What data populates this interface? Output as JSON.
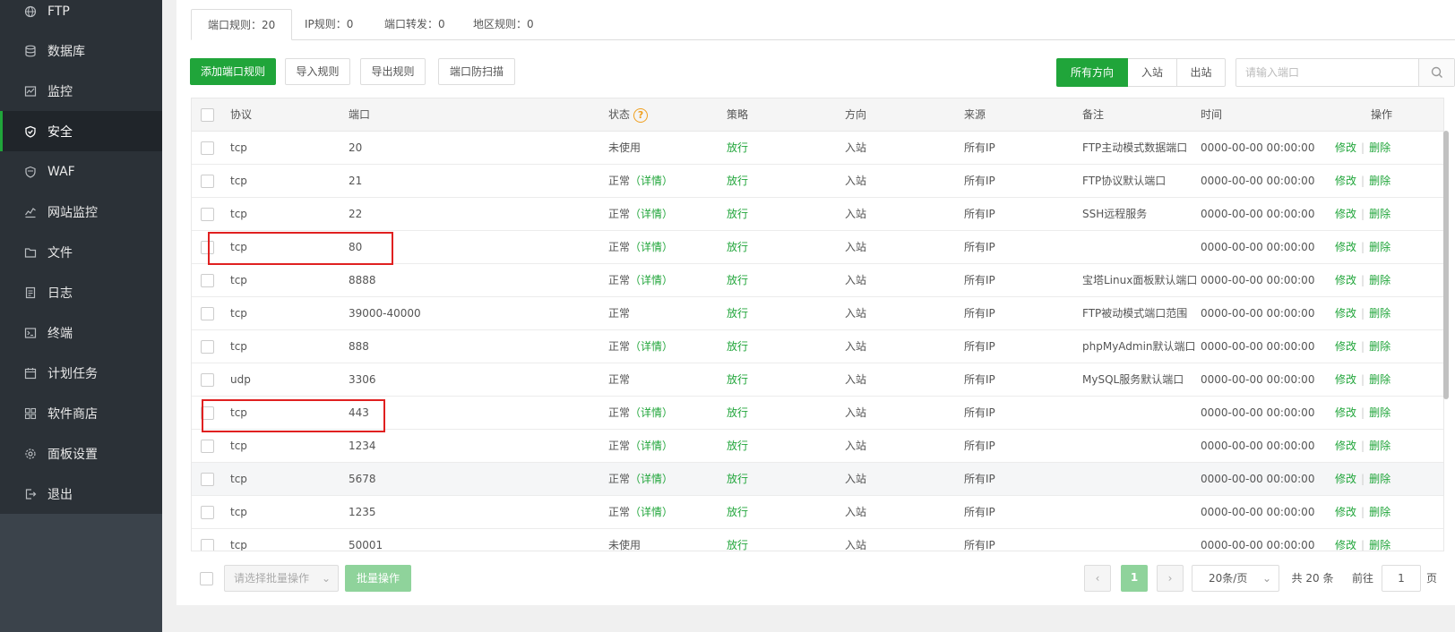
{
  "sidebar": {
    "items": [
      {
        "label": "FTP",
        "icon": "globe-icon"
      },
      {
        "label": "数据库",
        "icon": "database-icon"
      },
      {
        "label": "监控",
        "icon": "monitor-icon"
      },
      {
        "label": "安全",
        "icon": "shield-icon",
        "active": true
      },
      {
        "label": "WAF",
        "icon": "waf-shield-icon"
      },
      {
        "label": "网站监控",
        "icon": "chart-line-icon"
      },
      {
        "label": "文件",
        "icon": "folder-icon"
      },
      {
        "label": "日志",
        "icon": "log-icon"
      },
      {
        "label": "终端",
        "icon": "terminal-icon"
      },
      {
        "label": "计划任务",
        "icon": "calendar-icon"
      },
      {
        "label": "软件商店",
        "icon": "apps-icon"
      },
      {
        "label": "面板设置",
        "icon": "gear-icon"
      },
      {
        "label": "退出",
        "icon": "logout-icon"
      }
    ]
  },
  "tabs": [
    {
      "label": "端口规则：20",
      "active": true
    },
    {
      "label": "IP规则：0"
    },
    {
      "label": "端口转发：0"
    },
    {
      "label": "地区规则：0"
    }
  ],
  "toolbar": {
    "add_label": "添加端口规则",
    "import_label": "导入规则",
    "export_label": "导出规则",
    "scan_label": "端口防扫描",
    "dir_all": "所有方向",
    "dir_in": "入站",
    "dir_out": "出站",
    "search_placeholder": "请输入端口"
  },
  "table": {
    "headers": {
      "protocol": "协议",
      "port": "端口",
      "status": "状态",
      "policy": "策略",
      "direction": "方向",
      "source": "来源",
      "note": "备注",
      "time": "时间",
      "actions": "操作"
    },
    "help_glyph": "?",
    "detail_label": "（详情）",
    "edit_label": "修改",
    "delete_label": "删除",
    "action_sep": "|",
    "rows": [
      {
        "protocol": "tcp",
        "port": "20",
        "status": "未使用",
        "detail": false,
        "policy": "放行",
        "direction": "入站",
        "source": "所有IP",
        "note": "FTP主动模式数据端口",
        "time": "0000-00-00 00:00:00"
      },
      {
        "protocol": "tcp",
        "port": "21",
        "status": "正常",
        "detail": true,
        "policy": "放行",
        "direction": "入站",
        "source": "所有IP",
        "note": "FTP协议默认端口",
        "time": "0000-00-00 00:00:00"
      },
      {
        "protocol": "tcp",
        "port": "22",
        "status": "正常",
        "detail": true,
        "policy": "放行",
        "direction": "入站",
        "source": "所有IP",
        "note": "SSH远程服务",
        "time": "0000-00-00 00:00:00"
      },
      {
        "protocol": "tcp",
        "port": "80",
        "status": "正常",
        "detail": true,
        "policy": "放行",
        "direction": "入站",
        "source": "所有IP",
        "note": "",
        "time": "0000-00-00 00:00:00"
      },
      {
        "protocol": "tcp",
        "port": "8888",
        "status": "正常",
        "detail": true,
        "policy": "放行",
        "direction": "入站",
        "source": "所有IP",
        "note": "宝塔Linux面板默认端口",
        "time": "0000-00-00 00:00:00"
      },
      {
        "protocol": "tcp",
        "port": "39000-40000",
        "status": "正常",
        "detail": false,
        "policy": "放行",
        "direction": "入站",
        "source": "所有IP",
        "note": "FTP被动模式端口范围",
        "time": "0000-00-00 00:00:00"
      },
      {
        "protocol": "tcp",
        "port": "888",
        "status": "正常",
        "detail": true,
        "policy": "放行",
        "direction": "入站",
        "source": "所有IP",
        "note": "phpMyAdmin默认端口",
        "time": "0000-00-00 00:00:00"
      },
      {
        "protocol": "udp",
        "port": "3306",
        "status": "正常",
        "detail": false,
        "policy": "放行",
        "direction": "入站",
        "source": "所有IP",
        "note": "MySQL服务默认端口",
        "time": "0000-00-00 00:00:00"
      },
      {
        "protocol": "tcp",
        "port": "443",
        "status": "正常",
        "detail": true,
        "policy": "放行",
        "direction": "入站",
        "source": "所有IP",
        "note": "",
        "time": "0000-00-00 00:00:00"
      },
      {
        "protocol": "tcp",
        "port": "1234",
        "status": "正常",
        "detail": true,
        "policy": "放行",
        "direction": "入站",
        "source": "所有IP",
        "note": "",
        "time": "0000-00-00 00:00:00"
      },
      {
        "protocol": "tcp",
        "port": "5678",
        "status": "正常",
        "detail": true,
        "policy": "放行",
        "direction": "入站",
        "source": "所有IP",
        "note": "",
        "time": "0000-00-00 00:00:00"
      },
      {
        "protocol": "tcp",
        "port": "1235",
        "status": "正常",
        "detail": true,
        "policy": "放行",
        "direction": "入站",
        "source": "所有IP",
        "note": "",
        "time": "0000-00-00 00:00:00"
      },
      {
        "protocol": "tcp",
        "port": "50001",
        "status": "未使用",
        "detail": false,
        "policy": "放行",
        "direction": "入站",
        "source": "所有IP",
        "note": "",
        "time": "0000-00-00 00:00:00"
      }
    ]
  },
  "footer": {
    "batch_placeholder": "请选择批量操作",
    "batch_label": "批量操作",
    "prev_glyph": "‹",
    "next_glyph": "›",
    "select_arrow": "⌄",
    "current_page": "1",
    "per_page": "20条/页",
    "total": "共 20 条",
    "goto_label": "前往",
    "goto_value": "1",
    "page_unit": "页"
  }
}
